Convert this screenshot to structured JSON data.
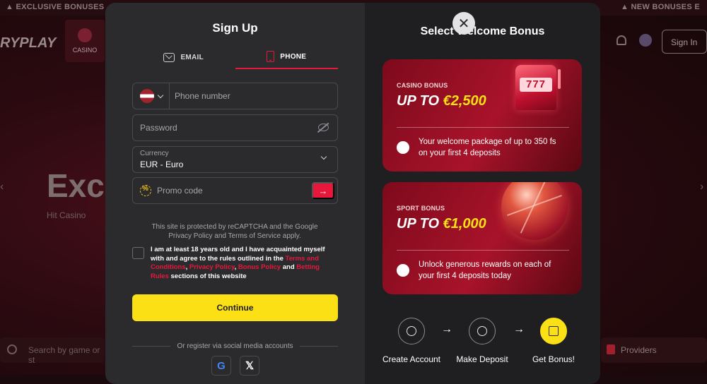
{
  "background": {
    "ticker_left": "▲ EXCLUSIVE BONUSES",
    "ticker_right": "▲ NEW BONUSES E",
    "logo": "RYPLAY",
    "nav_casino": "CASINO",
    "hero_title": "Excl",
    "hero_sub": "Hit Casino",
    "search_placeholder": "Search by game or st",
    "providers_label": "Providers",
    "signin_label": "Sign In"
  },
  "signup": {
    "title": "Sign Up",
    "tabs": [
      {
        "label": "EMAIL",
        "icon": "mail-icon",
        "active": false
      },
      {
        "label": "PHONE",
        "icon": "phone-icon",
        "active": true
      }
    ],
    "phone_placeholder": "Phone number",
    "country_flag": "latvia-flag-icon",
    "password_placeholder": "Password",
    "currency_label": "Currency",
    "currency_value": "EUR - Euro",
    "promo_placeholder": "Promo code",
    "recaptcha_text": "This site is protected by reCAPTCHA and the Google Privacy Policy and Terms of Service apply.",
    "agree_prefix": "I am at least 18 years old and I have acquainted myself with and agree to the rules outlined in the ",
    "agree_link1": "Terms and Conditions",
    "agree_sep1": ", ",
    "agree_link2": "Privacy Policy",
    "agree_sep2": ", ",
    "agree_link3": "Bonus Policy",
    "agree_sep3": " and ",
    "agree_link4": "Betting Rules",
    "agree_suffix": " sections of this website",
    "continue_label": "Continue",
    "social_text": "Or register via social media accounts",
    "social": [
      {
        "name": "google-icon",
        "glyph": "G"
      },
      {
        "name": "x-icon",
        "glyph": "𝕏"
      }
    ]
  },
  "bonus": {
    "title": "Select Welcome Bonus",
    "close_glyph": "✕",
    "cards": [
      {
        "kicker": "CASINO BONUS",
        "prefix": "UP TO ",
        "amount": "€2,500",
        "desc": "Your welcome package of up to 350 fs on your first 4 deposits",
        "art": "slot-machine-777",
        "slot_text": "777"
      },
      {
        "kicker": "SPORT BONUS",
        "prefix": "UP TO ",
        "amount": "€1,000",
        "desc": "Unlock generous rewards on each of your first 4 deposits today",
        "art": "basketball"
      }
    ],
    "steps": [
      {
        "label": "Create Account",
        "icon": "user-plus-icon"
      },
      {
        "label": "Make Deposit",
        "icon": "wallet-deposit-icon"
      },
      {
        "label": "Get Bonus!",
        "icon": "gift-icon"
      }
    ],
    "arrow_glyph": "→",
    "colors": {
      "accent_red": "#e8173c",
      "accent_yellow": "#fbe016"
    }
  }
}
